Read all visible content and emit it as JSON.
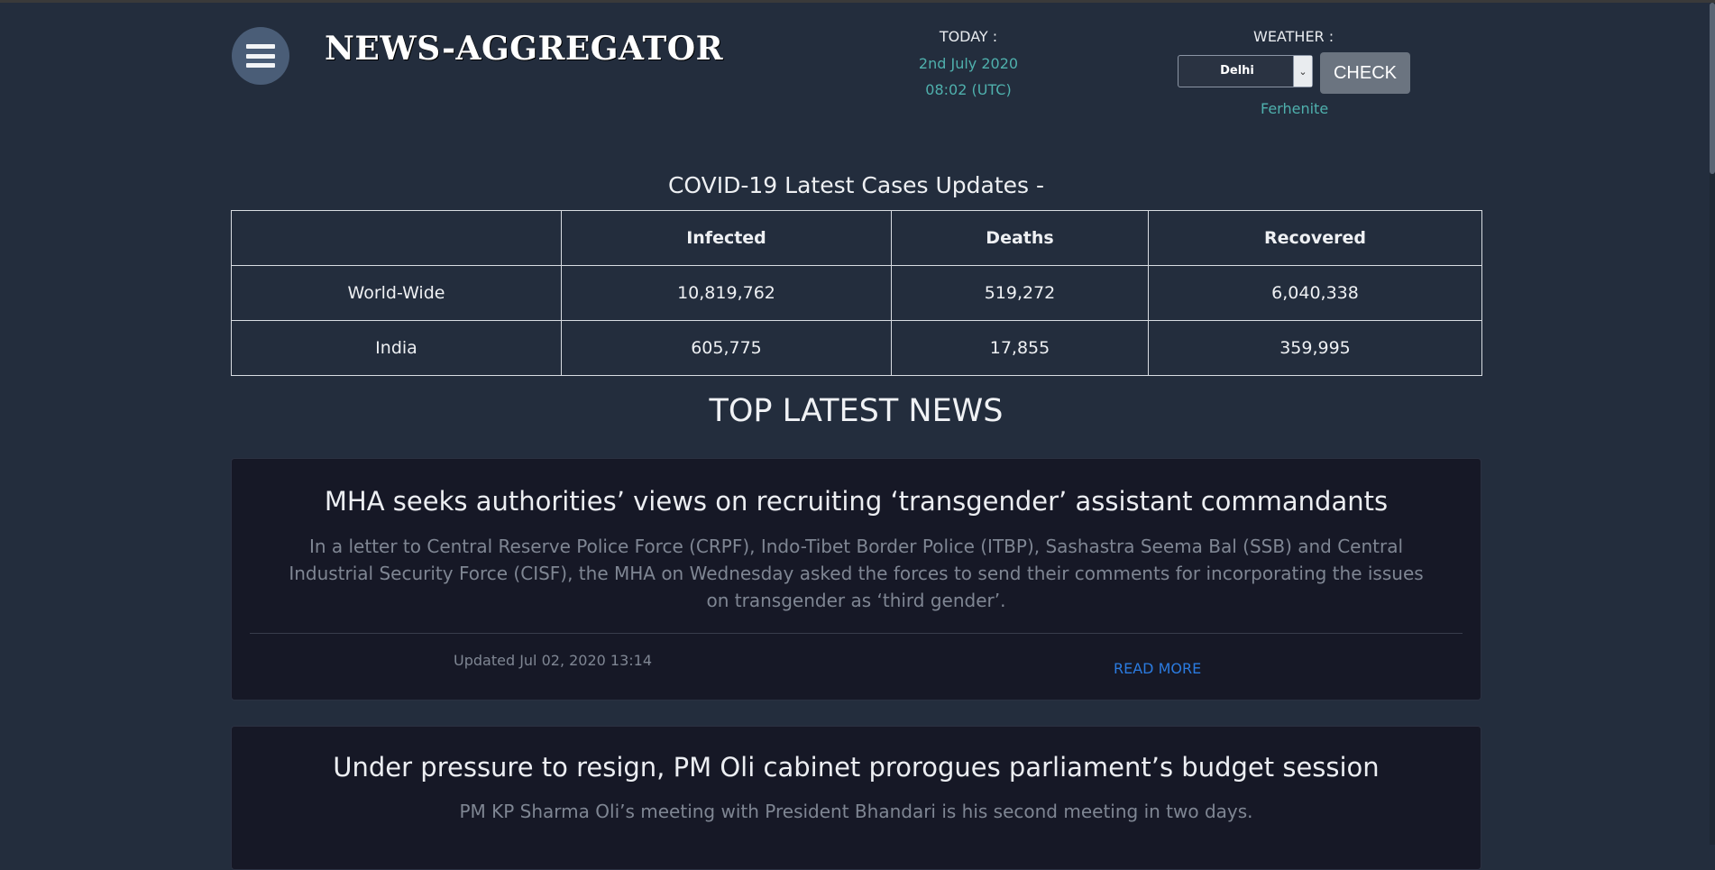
{
  "header": {
    "logo": "NEWS-AGGREGATOR",
    "today_label": "TODAY :",
    "date": "2nd July 2020",
    "time": "08:02 (UTC)",
    "weather_label": "WEATHER :",
    "city_selected": "Delhi",
    "check_label": "CHECK",
    "unit": "Ferhenite"
  },
  "covid": {
    "title": "COVID-19 Latest Cases Updates -",
    "columns": [
      "",
      "Infected",
      "Deaths",
      "Recovered"
    ],
    "rows": [
      [
        "World-Wide",
        "10,819,762",
        "519,272",
        "6,040,338"
      ],
      [
        "India",
        "605,775",
        "17,855",
        "359,995"
      ]
    ]
  },
  "news": {
    "section_title": "TOP LATEST NEWS",
    "items": [
      {
        "headline": "MHA seeks authorities’ views on recruiting ‘transgender’ assistant commandants",
        "description": "In a letter to Central Reserve Police Force (CRPF), Indo-Tibet Border Police (ITBP), Sashastra Seema Bal (SSB) and Central Industrial Security Force (CISF), the MHA on Wednesday asked the forces to send their comments for incorporating the issues on transgender as ‘third gender’.",
        "updated": "Updated Jul 02, 2020 13:14",
        "read_more": "READ MORE"
      },
      {
        "headline": "Under pressure to resign, PM Oli cabinet prorogues parliament’s budget session",
        "description": "PM KP Sharma Oli’s meeting with President Bhandari is his second meeting in two days."
      }
    ]
  },
  "colors": {
    "background": "#232d3d",
    "accent_teal": "#4fb0ad",
    "link_blue": "#2b7be0",
    "card_bg": "#161826"
  }
}
